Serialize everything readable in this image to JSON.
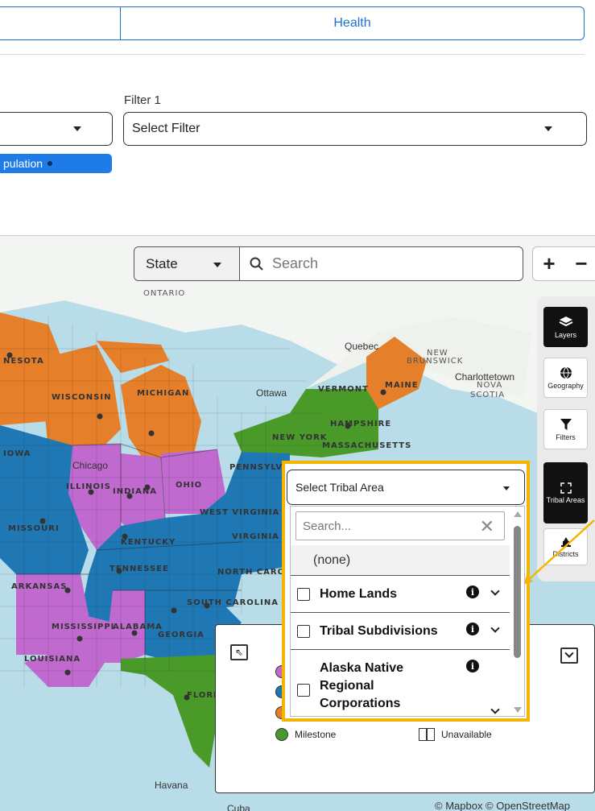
{
  "tabs": {
    "left_label": "",
    "right_label": "Health"
  },
  "filters": {
    "label_1": "Filter 1",
    "left_select_value": "",
    "filter1_value": "Select Filter",
    "chip_label": "pulation"
  },
  "map_search": {
    "state_select": "State",
    "search_placeholder": "Search",
    "zoom_in": "+",
    "zoom_out": "−"
  },
  "map_labels": {
    "ontario": "ONTARIO",
    "quebec": "Quebec",
    "new_brunswick_1": "NEW",
    "new_brunswick_2": "BRUNSWICK",
    "charlottetown": "Charlottetown",
    "nova_scotia_1": "NOVA",
    "nova_scotia_2": "SCOTIA",
    "ottawa": "Ottawa",
    "maine": "MAINE",
    "vermont": "VERMONT",
    "hampshire": "HAMPSHIRE",
    "new_york": "NEW YORK",
    "massachusetts": "MASSACHUSETTS",
    "wisconsin": "WISCONSIN",
    "michigan": "MICHIGAN",
    "minnesota": "NESOTA",
    "iowa": "IOWA",
    "chicago": "Chicago",
    "illinois": "ILLINOIS",
    "indiana": "INDIANA",
    "ohio": "OHIO",
    "pennsylvania": "PENNSYLVANIA",
    "missouri": "MISSOURI",
    "kentucky": "KENTUCKY",
    "west_virginia": "WEST VIRGINIA",
    "virginia": "VIRGINIA",
    "tennessee": "TENNESSEE",
    "north_carolina": "NORTH CAROLINA",
    "south_carolina": "SOUTH CAROLINA",
    "arkansas": "ARKANSAS",
    "mississippi": "MISSISSIPPI",
    "alabama": "ALABAMA",
    "georgia": "GEORGIA",
    "louisiana": "LOUISIANA",
    "florida": "FLORIDA",
    "havana": "Havana",
    "cuba": "Cuba"
  },
  "tools": [
    {
      "label": "Layers",
      "icon": "layers-icon"
    },
    {
      "label": "Geography",
      "icon": "globe-icon"
    },
    {
      "label": "Filters",
      "icon": "filter-icon"
    },
    {
      "label": "Tribal Areas",
      "icon": "expand-icon"
    },
    {
      "label": "Districts",
      "icon": "capitol-icon"
    }
  ],
  "tribal": {
    "select_label": "Select Tribal Area",
    "search_placeholder": "Search...",
    "none_option": "(none)",
    "options": [
      {
        "label": "Home Lands"
      },
      {
        "label": "Tribal Subdivisions"
      },
      {
        "label_lines": [
          "Alaska Native",
          "Regional",
          "Corporations"
        ]
      }
    ]
  },
  "legend": {
    "items": [
      {
        "label": "Milestone",
        "color": "#4a9a2a"
      },
      {
        "label": "Unavailable"
      }
    ]
  },
  "attribution": "© Mapbox © OpenStreetMap",
  "colors": {
    "accent": "#1f6fd1",
    "orange": "#e57f2a",
    "purple": "#c06ad0",
    "blue": "#1f78b4",
    "green": "#4a9a2a",
    "highlight": "#f5b400"
  }
}
